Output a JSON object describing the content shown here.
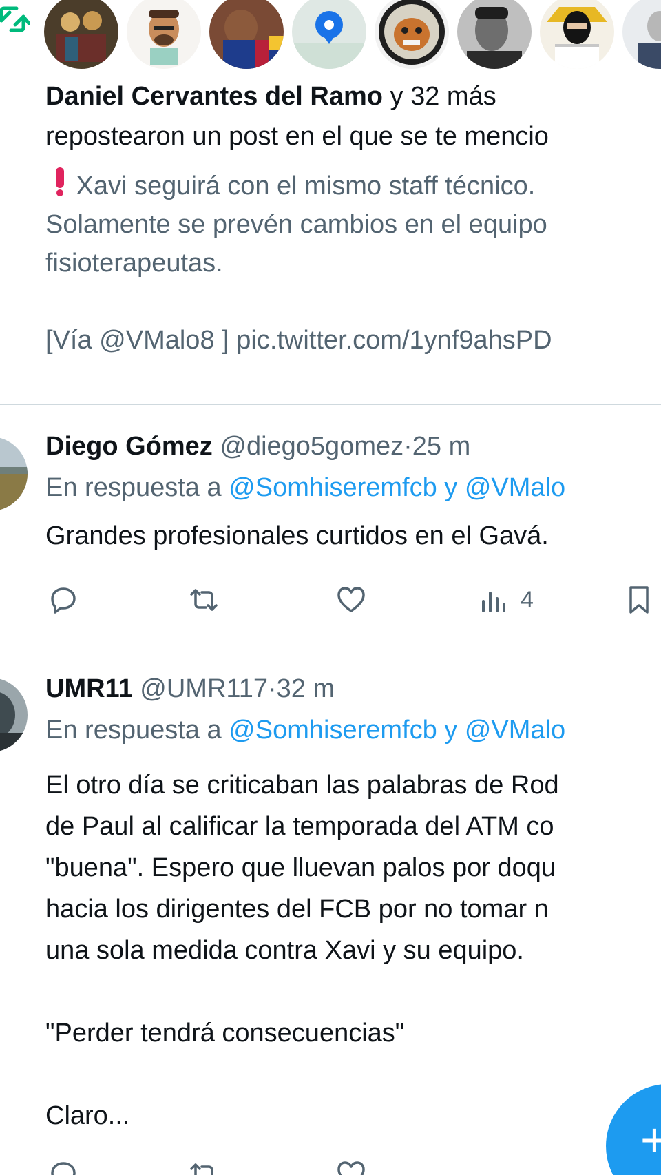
{
  "notification": {
    "avatars": [
      {
        "name": "avatar-1",
        "color": "#4b3d2a"
      },
      {
        "name": "avatar-2",
        "color": "#f3f1ee"
      },
      {
        "name": "avatar-3",
        "color": "#7a4a35"
      },
      {
        "name": "avatar-4",
        "color": "#dfe8e4"
      },
      {
        "name": "avatar-5",
        "color": "#f2f2f2"
      },
      {
        "name": "avatar-6",
        "color": "#3a3a3a"
      },
      {
        "name": "avatar-7",
        "color": "#f4f0e6"
      },
      {
        "name": "avatar-8",
        "color": "#e9ecef"
      }
    ],
    "actor": "Daniel Cervantes del Ramo",
    "actor_suffix": " y 32 más",
    "line2": "repostearon un post en el que se te mencio",
    "quote_line1": " Xavi seguirá con el mismo staff técnico.",
    "quote_line2": "Solamente se prevén cambios en el equipo",
    "quote_line3": "fisioterapeutas.",
    "quote_line4": "[Vía @VMalo8 ] pic.twitter.com/1ynf9ahsPD"
  },
  "tweets": [
    {
      "name": "Diego Gómez",
      "handle": "@diego5gomez",
      "time": "25 m",
      "reply_prefix": "En respuesta a ",
      "reply_to": "@Somhiseremfcb y @VMalo",
      "lines": [
        "Grandes profesionales curtidos en el Gavá."
      ],
      "views": "4"
    },
    {
      "name": "UMR11",
      "handle": "@UMR117",
      "time": "32 m",
      "reply_prefix": "En respuesta a ",
      "reply_to": "@Somhiseremfcb y @VMalo",
      "lines": [
        "El otro día se criticaban las palabras de Rod",
        "de Paul al calificar la temporada del ATM co",
        "\"buena\". Espero que lluevan palos por doqu",
        "hacia los dirigentes del FCB por no tomar n",
        "una sola medida contra Xavi y su equipo.",
        "",
        "\"Perder tendrá consecuencias\"",
        "",
        "Claro..."
      ],
      "views": ""
    }
  ],
  "fab": {
    "label": "+"
  }
}
